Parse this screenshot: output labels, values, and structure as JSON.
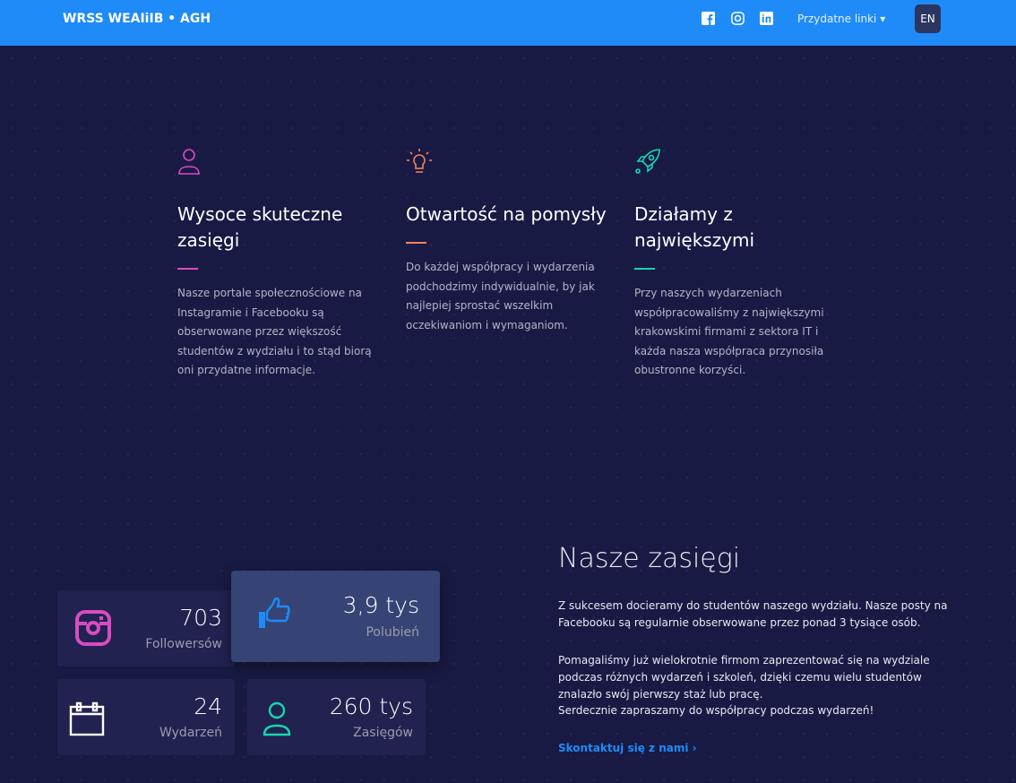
{
  "nav": {
    "brand": "WRSS WEAIiIB • AGH",
    "links": "Przydatne linki ▾",
    "lang": "EN"
  },
  "features": [
    {
      "title": "Wysoce skuteczne zasięgi",
      "text": "Nasze portale społecznościowe na Instagramie i Facebooku są obserwowane przez większość studentów z wydziału i to stąd biorą oni przydatne informacje.",
      "color": "#d94bc1"
    },
    {
      "title": "Otwartość na pomysły",
      "text": "Do każdej współpracy i wydarzenia podchodzimy indywidualnie, by jak najlepiej sprostać wszelkim oczekiwaniom i wymaganiom.",
      "color": "#f5845f"
    },
    {
      "title": "Działamy z największymi",
      "text": "Przy naszych wydarzeniach współpracowaliśmy z największymi krakowskimi firmami z sektora IT i każda nasza współpraca przynosiła obustronne korzyści.",
      "color": "#18d6b0"
    }
  ],
  "stats": [
    {
      "value": "703",
      "label": "Followersów"
    },
    {
      "value": "3,9 tys",
      "label": "Polubień"
    },
    {
      "value": "24",
      "label": "Wydarzeń"
    },
    {
      "value": "260 tys",
      "label": "Zasięgów"
    }
  ],
  "reach": {
    "title": "Nasze zasięgi",
    "p1": "Z sukcesem docieramy do studentów naszego wydziału. Nasze posty na Facebooku są regularnie obserwowane przez ponad 3 tysiące osób.",
    "p2": "Pomagaliśmy już wielokrotnie firmom zaprezentować się na wydziale podczas różnych wydarzeń i szkoleń, dzięki czemu wielu studentów znalazło swój pierwszy staż lub pracę.",
    "p3": "Serdecznie zapraszamy do współpracy podczas wydarzeń!",
    "cta": "Skontaktuj się z nami ›"
  }
}
